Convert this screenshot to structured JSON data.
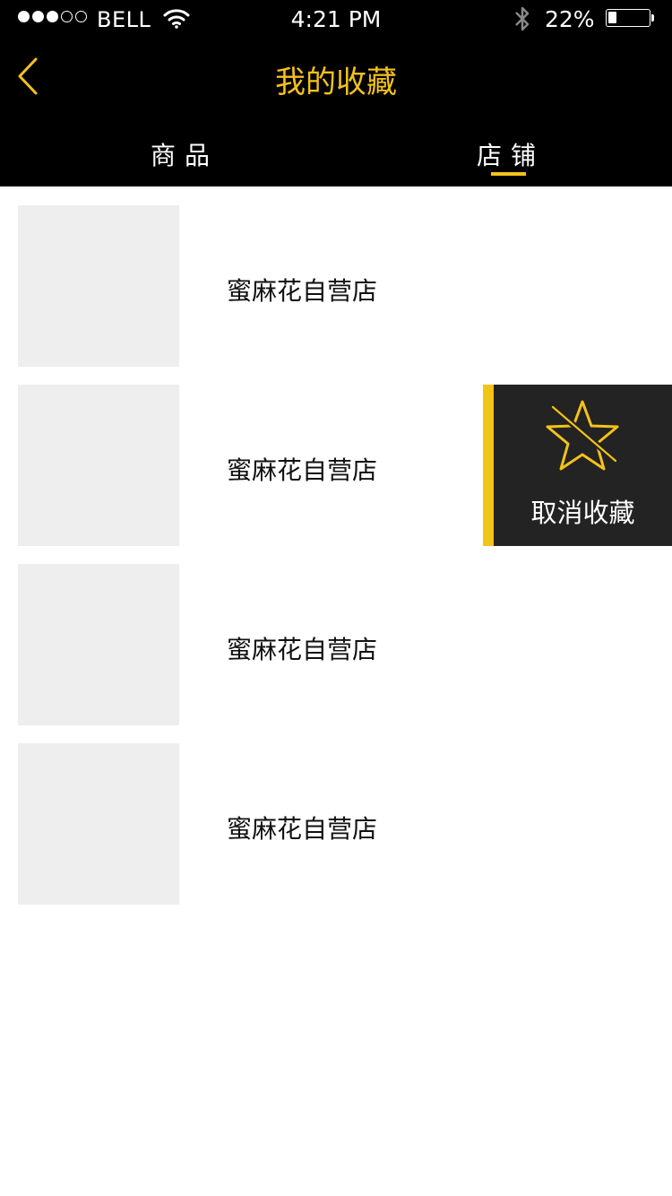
{
  "status_bar": {
    "carrier": "BELL",
    "time": "4:21 PM",
    "battery_percent": "22%",
    "battery_level": 0.22,
    "signal_bars_filled": 3,
    "signal_bars_total": 5
  },
  "header": {
    "title": "我的收藏",
    "back_icon": "chevron-left-icon",
    "tabs": [
      {
        "label": "商品",
        "active": false
      },
      {
        "label": "店铺",
        "active": true
      }
    ]
  },
  "shops": [
    {
      "name": "蜜麻花自营店"
    },
    {
      "name": "蜜麻花自营店"
    },
    {
      "name": "蜜麻花自营店"
    },
    {
      "name": "蜜麻花自营店"
    }
  ],
  "swipe_action": {
    "label": "取消收藏",
    "icon": "star-slash-icon"
  },
  "colors": {
    "accent": "#f5c21a",
    "header_bg": "#000000",
    "action_bg": "#232323",
    "thumb_bg": "#eeeeee"
  }
}
